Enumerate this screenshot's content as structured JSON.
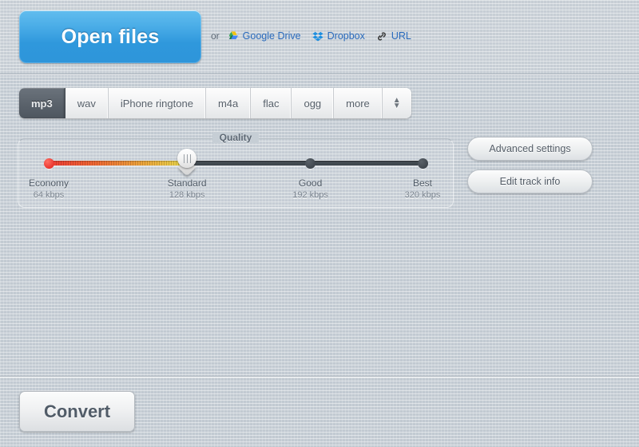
{
  "header": {
    "open_files_label": "Open files",
    "or_text": "or",
    "sources": [
      {
        "label": "Google Drive",
        "icon": "google-drive-icon"
      },
      {
        "label": "Dropbox",
        "icon": "dropbox-icon"
      },
      {
        "label": "URL",
        "icon": "link-icon"
      }
    ]
  },
  "format_tabs": {
    "items": [
      {
        "label": "mp3",
        "active": true
      },
      {
        "label": "wav",
        "active": false
      },
      {
        "label": "iPhone ringtone",
        "active": false
      },
      {
        "label": "m4a",
        "active": false
      },
      {
        "label": "flac",
        "active": false
      },
      {
        "label": "ogg",
        "active": false
      },
      {
        "label": "more",
        "active": false
      }
    ],
    "stepper_up": "▲",
    "stepper_down": "▼",
    "selected": "mp3"
  },
  "quality": {
    "title": "Quality",
    "selected_index": 1,
    "selected_value": "128 kbps",
    "stops": [
      {
        "name": "Economy",
        "rate": "64 kbps",
        "position": 0
      },
      {
        "name": "Standard",
        "rate": "128 kbps",
        "position": 37
      },
      {
        "name": "Good",
        "rate": "192 kbps",
        "position": 70
      },
      {
        "name": "Best",
        "rate": "320 kbps",
        "position": 100
      }
    ]
  },
  "side_buttons": [
    {
      "label": "Advanced settings"
    },
    {
      "label": "Edit track info"
    }
  ],
  "footer": {
    "convert_label": "Convert"
  },
  "colors": {
    "page_background": "#c2cad2",
    "primary_button": "#2f98dc",
    "active_tab": "#5a626b",
    "link": "#2a6bbd",
    "slider_fill_start": "#ef3b34",
    "slider_fill_end": "#e9da4c",
    "slider_track": "#42494f"
  }
}
